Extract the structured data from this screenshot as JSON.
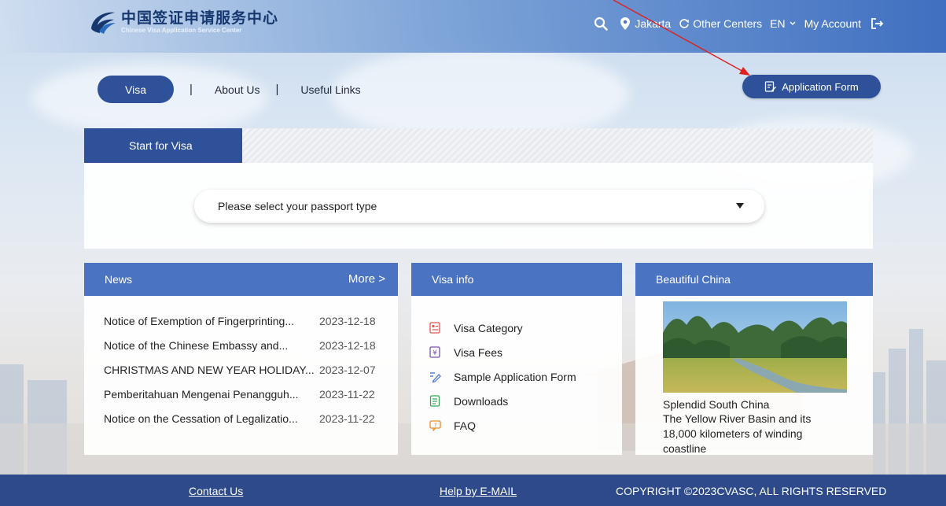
{
  "header": {
    "logo_cn": "中国签证申请服务中心",
    "logo_en": "Chinese Visa Application Service Center",
    "location": "Jakarta",
    "other_centers": "Other Centers",
    "language": "EN",
    "my_account": "My Account",
    "icons": [
      "search-icon",
      "location-pin-icon",
      "refresh-icon",
      "chevron-down-icon",
      "logout-icon"
    ]
  },
  "tabs": [
    {
      "label": "Visa",
      "active": true
    },
    {
      "label": "About Us",
      "active": false
    },
    {
      "label": "Useful Links",
      "active": false
    }
  ],
  "tab_separator": "|",
  "application_form": {
    "label": "Application Form",
    "icon": "edit-form-icon"
  },
  "visa_panel": {
    "tab_label": "Start for Visa",
    "passport_select": {
      "value": "Please select your passport type"
    }
  },
  "news": {
    "title": "News",
    "more_label": "More >",
    "items": [
      {
        "title": "Notice of Exemption of Fingerprinting...",
        "date": "2023-12-18"
      },
      {
        "title": "Notice of the Chinese Embassy and...",
        "date": "2023-12-18"
      },
      {
        "title": "CHRISTMAS AND NEW YEAR HOLIDAY...",
        "date": "2023-12-07"
      },
      {
        "title": "Pemberitahuan Mengenai Penangguh...",
        "date": "2023-11-22"
      },
      {
        "title": "Notice on the Cessation of Legalizatio...",
        "date": "2023-11-22"
      }
    ]
  },
  "visa_info": {
    "title": "Visa info",
    "items": [
      {
        "label": "Visa Category",
        "icon": "category-icon",
        "color": "#e8544e"
      },
      {
        "label": "Visa Fees",
        "icon": "yen-icon",
        "color": "#7a4fb0"
      },
      {
        "label": "Sample Application Form",
        "icon": "pen-icon",
        "color": "#3b6fd0"
      },
      {
        "label": "Downloads",
        "icon": "document-icon",
        "color": "#36a55a"
      },
      {
        "label": "FAQ",
        "icon": "faq-icon",
        "color": "#f08a24"
      }
    ]
  },
  "beautiful_china": {
    "title": "Beautiful China",
    "caption_title": "Splendid South China",
    "caption_desc": "The Yellow River Basin and its 18,000 kilometers of winding coastline"
  },
  "footer": {
    "contact": "Contact Us",
    "help": "Help by E-MAIL",
    "copyright": "COPYRIGHT ©2023CVASC, ALL RIGHTS RESERVED"
  },
  "colors": {
    "primary": "#2e5199",
    "card_header": "#4a74c2",
    "footer": "#2e4a8a",
    "annotation": "#e02020"
  }
}
